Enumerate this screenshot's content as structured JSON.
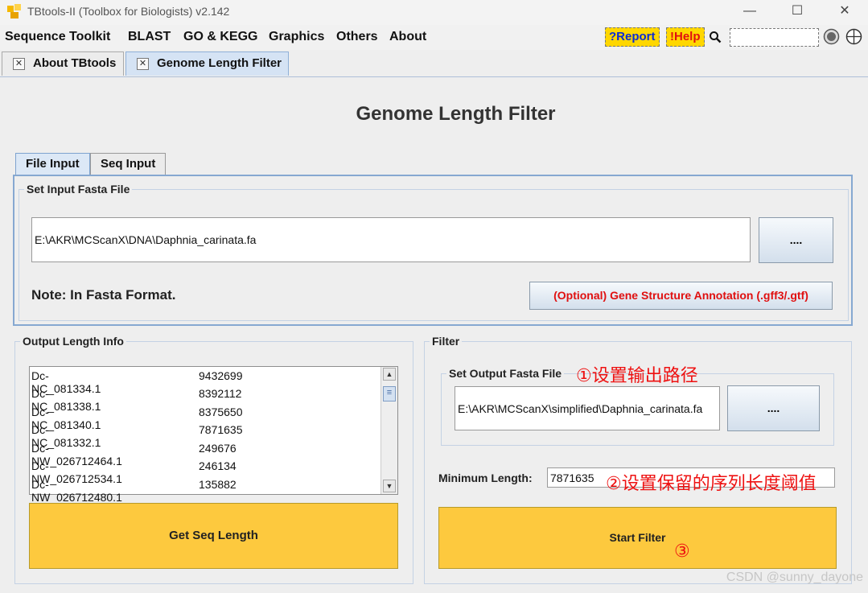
{
  "window": {
    "title": "TBtools-II (Toolbox for Biologists) v2.142",
    "minimize_glyph": "—",
    "maximize_glyph": "☐",
    "close_glyph": "✕"
  },
  "menu": {
    "items": [
      "Sequence Toolkit",
      "BLAST",
      "GO & KEGG",
      "Graphics",
      "Others",
      "About"
    ],
    "report_label": "?Report",
    "help_label": "!Help",
    "search_value": ""
  },
  "tabs": [
    {
      "label": "About TBtools"
    },
    {
      "label": "Genome Length Filter"
    }
  ],
  "page_title": "Genome Length Filter",
  "input_tabs": [
    "File Input",
    "Seq Input"
  ],
  "input_section": {
    "legend": "Set Input Fasta File",
    "path": "E:\\AKR\\MCScanX\\DNA\\Daphnia_carinata.fa",
    "browse_label": "....",
    "note": "Note: In Fasta Format.",
    "annotation_button": "(Optional) Gene Structure Annotation (.gff3/.gtf)"
  },
  "output_info": {
    "legend": "Output Length Info",
    "rows": [
      {
        "id": "Dc-NC_081334.1",
        "length": "9432699"
      },
      {
        "id": "Dc-NC_081338.1",
        "length": "8392112"
      },
      {
        "id": "Dc-NC_081340.1",
        "length": "8375650"
      },
      {
        "id": "Dc-NC_081332.1",
        "length": "7871635"
      },
      {
        "id": "Dc-NW_026712464.1",
        "length": "249676"
      },
      {
        "id": "Dc-NW_026712534.1",
        "length": "246134"
      },
      {
        "id": "Dc-NW_026712480.1",
        "length": "135882"
      }
    ],
    "get_length_button": "Get Seq Length"
  },
  "filter": {
    "legend": "Filter",
    "output_legend": "Set Output Fasta File",
    "output_path": "E:\\AKR\\MCScanX\\simplified\\Daphnia_carinata.fa",
    "browse_label": "....",
    "min_length_label": "Minimum Length:",
    "min_length_value": "7871635",
    "start_button": "Start Filter"
  },
  "annotations": {
    "step1": "①设置输出路径",
    "step2": "②设置保留的序列长度阈值",
    "step3": "③"
  },
  "watermark": "CSDN @sunny_dayone",
  "colors": {
    "accent_blue": "#86a8d1",
    "button_yellow": "#fdc93e",
    "highlight_yellow": "#ffd700",
    "annotation_red": "#ee1111",
    "report_blue": "#0a2bd6",
    "help_red": "#e01010"
  }
}
